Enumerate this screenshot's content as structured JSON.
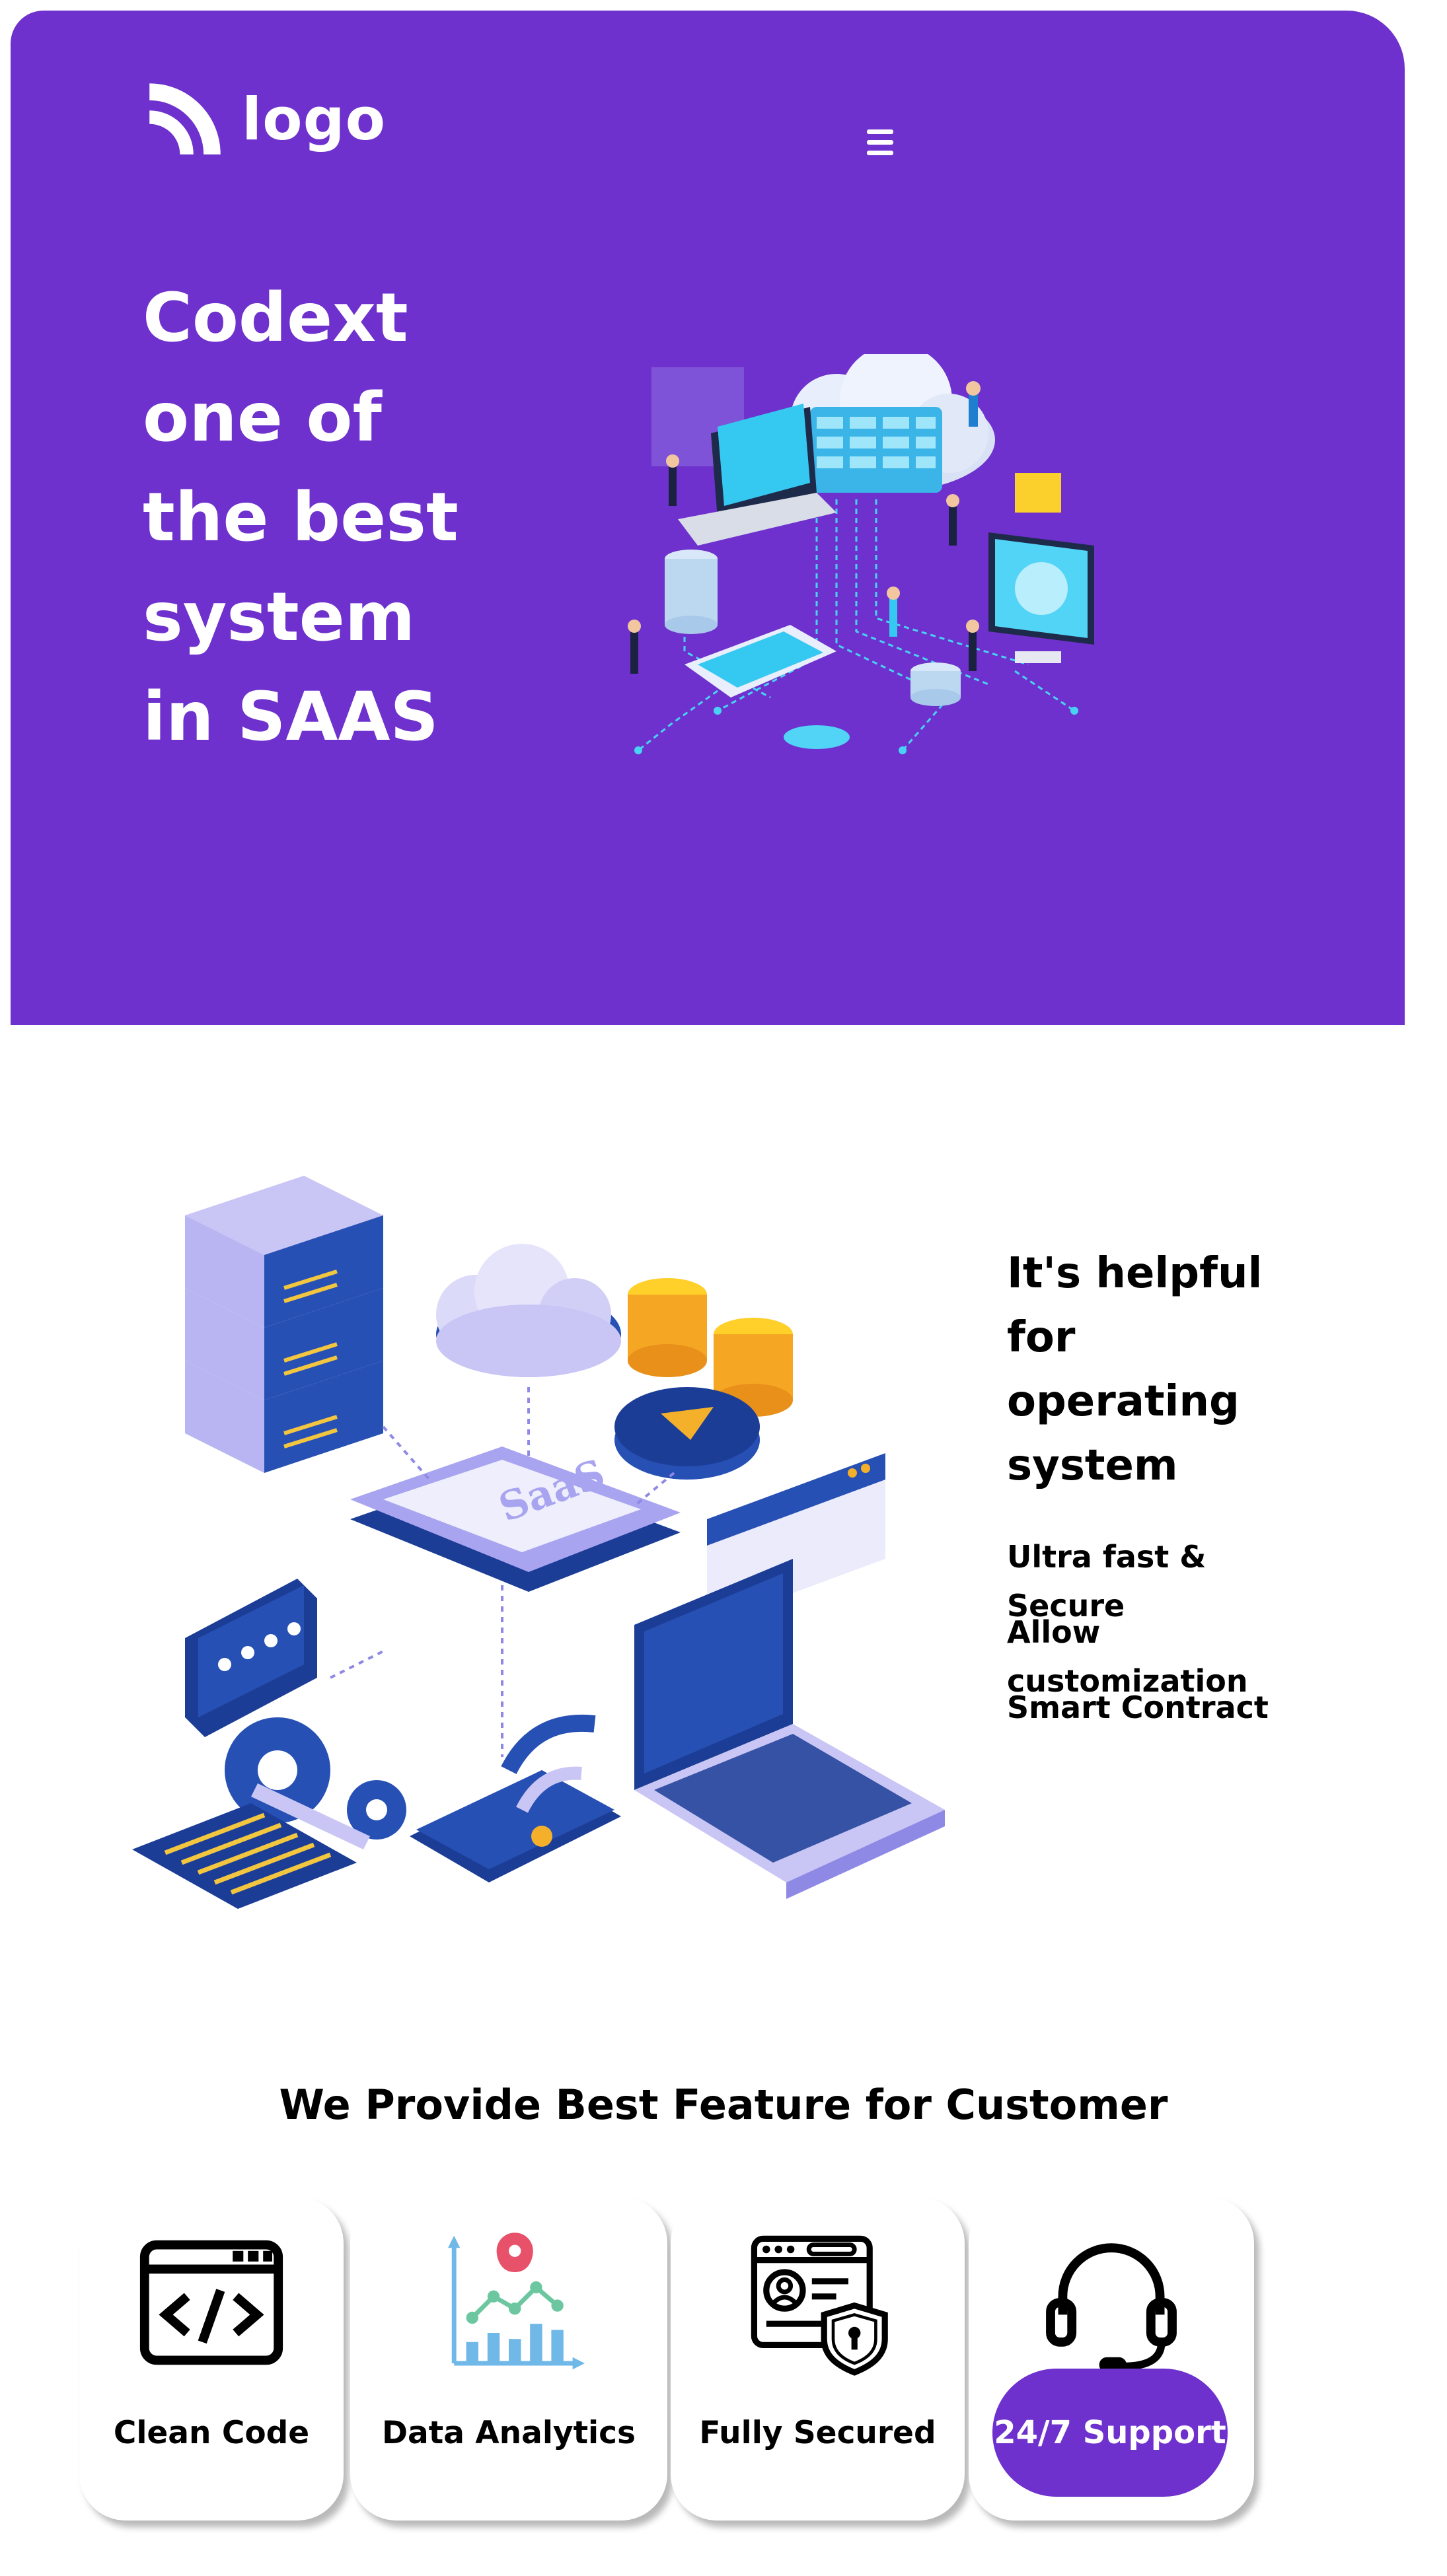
{
  "header": {
    "logo_text": "logo",
    "logo_icon": "signal-arcs-icon",
    "menu_icon": "hamburger-menu-icon"
  },
  "hero": {
    "title": "Codext one of the best system in SAAS",
    "background_color": "#6e31cd"
  },
  "about": {
    "title": "It's helpful for operating system",
    "points": [
      "Ultra fast & Secure",
      "Allow customization",
      "Smart Contract"
    ]
  },
  "illustrations": {
    "saas_label": "SaaS"
  },
  "features": {
    "title": "We Provide Best Feature for Customer",
    "cards": [
      {
        "label": "Clean Code",
        "icon": "code-window-icon"
      },
      {
        "label": "Data Analytics",
        "icon": "analytics-chart-icon"
      },
      {
        "label": "Fully Secured",
        "icon": "secure-profile-icon"
      },
      {
        "label": "24/7 Support",
        "icon": "headset-icon"
      }
    ]
  },
  "colors": {
    "accent": "#6e31cd",
    "text": "#000000",
    "illustration_blue": "#1d4aa8",
    "illustration_cyan": "#35c8f0"
  }
}
